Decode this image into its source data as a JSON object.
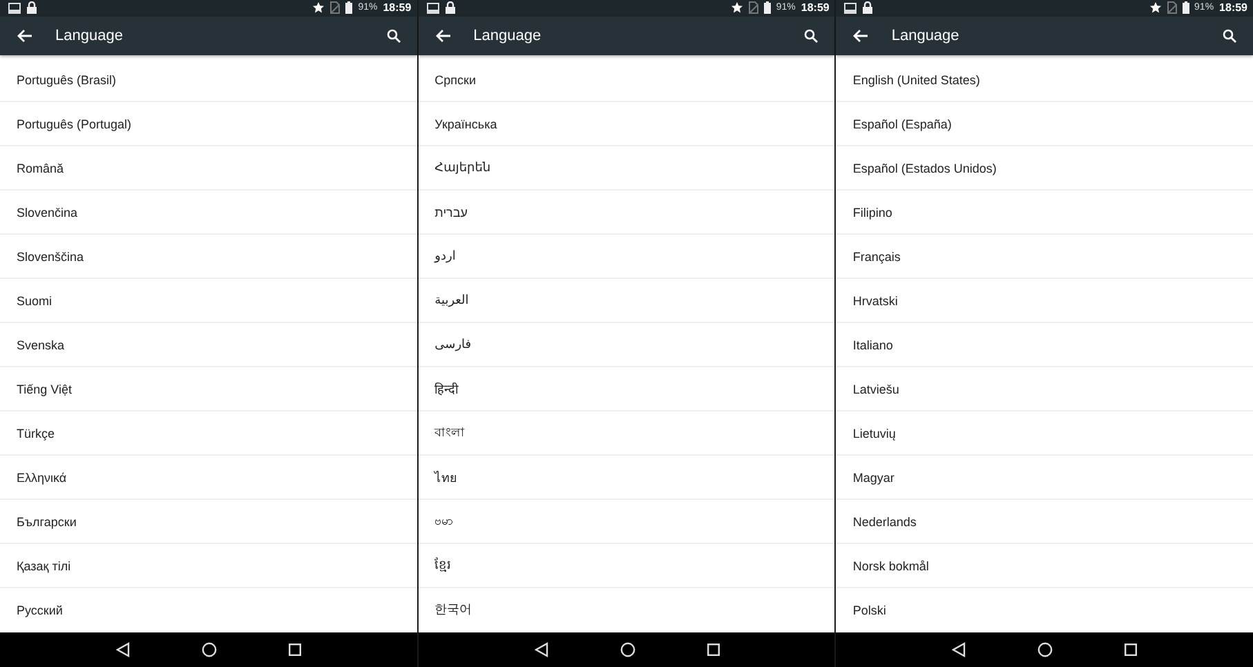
{
  "screens": [
    {
      "status_bar": {
        "battery": "91%",
        "time": "18:59"
      },
      "toolbar": {
        "title": "Language"
      },
      "languages": [
        "Português (Brasil)",
        "Português (Portugal)",
        "Română",
        "Slovenčina",
        "Slovenščina",
        "Suomi",
        "Svenska",
        "Tiếng Việt",
        "Türkçe",
        "Ελληνικά",
        "Български",
        "Қазақ тілі",
        "Русский"
      ]
    },
    {
      "status_bar": {
        "battery": "91%",
        "time": "18:59"
      },
      "toolbar": {
        "title": "Language"
      },
      "languages": [
        "Српски",
        "Українська",
        "Հայերեն",
        "עברית",
        "اردو",
        "العربية",
        "فارسی",
        "हिन्दी",
        "বাংলা",
        "ไทย",
        "ဗမာ",
        "ខ្មែរ",
        "한국어"
      ]
    },
    {
      "status_bar": {
        "battery": "91%",
        "time": "18:59"
      },
      "toolbar": {
        "title": "Language"
      },
      "languages": [
        "English (United States)",
        "Español (España)",
        "Español (Estados Unidos)",
        "Filipino",
        "Français",
        "Hrvatski",
        "Italiano",
        "Latviešu",
        "Lietuvių",
        "Magyar",
        "Nederlands",
        "Norsk bokmål",
        "Polski"
      ]
    }
  ]
}
